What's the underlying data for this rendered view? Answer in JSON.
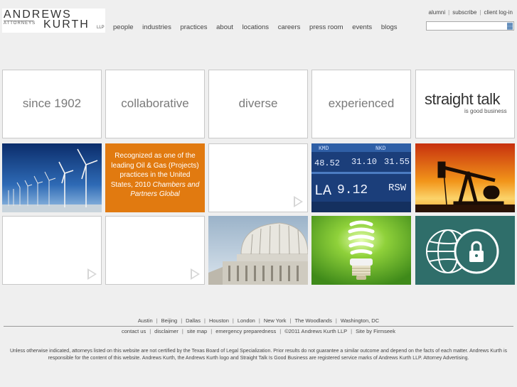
{
  "logo": {
    "line1": "ANDREWS",
    "line2": "ATTORNEYS",
    "line3": "KURTH",
    "line4": "LLP"
  },
  "nav": [
    "people",
    "industries",
    "practices",
    "about",
    "locations",
    "careers",
    "press room",
    "events",
    "blogs"
  ],
  "util": [
    "alumni",
    "subscribe",
    "client log-in"
  ],
  "search": {
    "placeholder": "",
    "value": ""
  },
  "tiles": {
    "since": "since 1902",
    "collab": "collaborative",
    "diverse": "diverse",
    "experienced": "experienced",
    "straight_talk": "straight talk",
    "straight_sub": "is good business",
    "recognized_1": "Recognized as one of the leading Oil & Gas (Projects) practices in the United States, 2010 ",
    "recognized_2": "Chambers and Partners Global",
    "ticker": [
      "KMD",
      "NKD",
      "48.52",
      "31.10",
      "31.55",
      "LA",
      "9.12",
      "RSW"
    ]
  },
  "cities": [
    "Austin",
    "Beijing",
    "Dallas",
    "Houston",
    "London",
    "New York",
    "The Woodlands",
    "Washington, DC"
  ],
  "footer_links": [
    "contact us",
    "disclaimer",
    "site map",
    "emergency preparedness",
    "©2011 Andrews Kurth LLP",
    "Site by Firmseek"
  ],
  "disclaimer": "Unless otherwise indicated, attorneys listed on this website are not certified by the Texas Board of Legal Specialization. Prior results do not guarantee a similar outcome and depend on the facts of each matter. Andrews Kurth is responsible for the content of this website. Andrews Kurth, the Andrews Kurth logo and Straight Talk Is Good Business are registered service marks of Andrews Kurth LLP. Attorney Advertising."
}
